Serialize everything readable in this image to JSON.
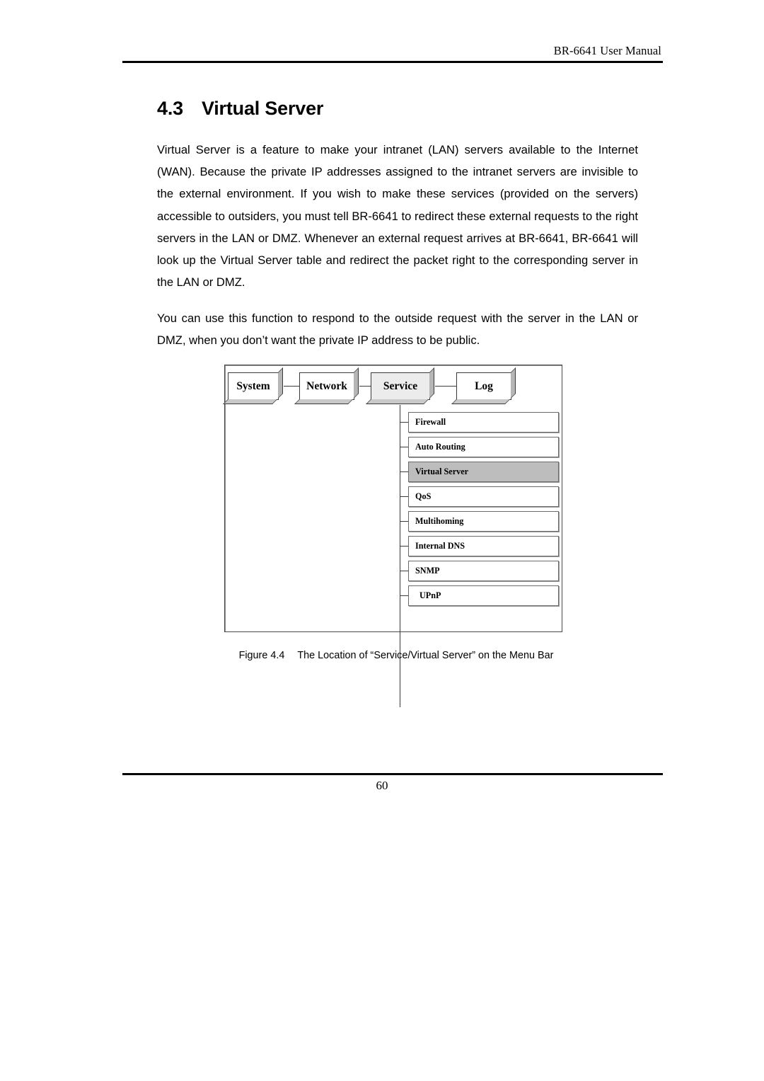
{
  "document": {
    "running_header": "BR-6641 User Manual",
    "page_number": "60"
  },
  "section": {
    "number": "4.3",
    "title": "Virtual Server"
  },
  "body": {
    "paragraph_1": "Virtual Server is a feature to make your intranet (LAN) servers available to the Internet (WAN). Because the private IP addresses assigned to the intranet servers are invisible to the external environment. If you wish to make these services (provided on the servers) accessible to outsiders, you must tell BR-6641 to redirect these external requests to the right servers in the LAN or DMZ. Whenever an external request arrives at BR-6641, BR-6641 will look up the Virtual Server table and redirect the packet right to the corresponding server in the LAN or DMZ.",
    "paragraph_2": "You can use this function to respond to the outside request with the server in the LAN or DMZ, when you don’t want the private IP address to be public."
  },
  "figure": {
    "caption_number": "Figure 4.4",
    "caption_text": "The Location of “Service/Virtual Server” on the Menu Bar",
    "menu_bar": {
      "tabs": [
        {
          "label": "System",
          "selected": false
        },
        {
          "label": "Network",
          "selected": false
        },
        {
          "label": "Service",
          "selected": true
        },
        {
          "label": "Log",
          "selected": false
        }
      ],
      "selected_tab": "Service"
    },
    "submenu": {
      "parent": "Service",
      "selected_item": "Virtual Server",
      "items": [
        {
          "label": "Firewall",
          "selected": false
        },
        {
          "label": "Auto Routing",
          "selected": false
        },
        {
          "label": "Virtual Server",
          "selected": true
        },
        {
          "label": "QoS",
          "selected": false
        },
        {
          "label": "Multihoming",
          "selected": false
        },
        {
          "label": "Internal DNS",
          "selected": false
        },
        {
          "label": "SNMP",
          "selected": false
        },
        {
          "label": "UPnP",
          "selected": false
        }
      ]
    },
    "colors": {
      "tab_selected_fill": "#ececec",
      "submenu_selected_fill": "#bdbdbd",
      "box_border": "#3a3a3a",
      "shadow_face": "#b6b6b6"
    }
  }
}
